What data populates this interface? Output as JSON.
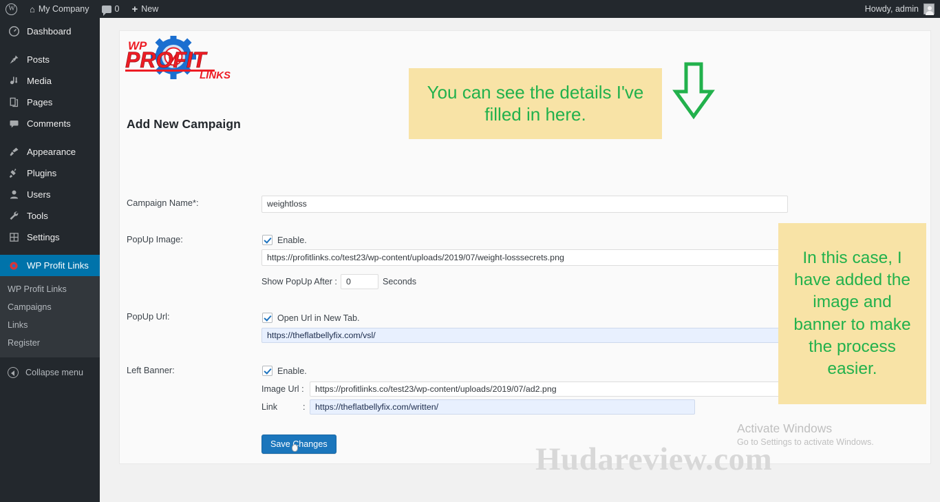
{
  "adminbar": {
    "wp_logo": "wordpress-logo-icon",
    "site_name": "My Company",
    "comments_count": "0",
    "new_label": "New",
    "howdy": "Howdy, admin"
  },
  "sidebar": {
    "items": [
      {
        "label": "Dashboard",
        "icon": "dashboard-icon",
        "glyph": "◉"
      },
      {
        "label": "Posts",
        "icon": "pin-icon",
        "glyph": "✎"
      },
      {
        "label": "Media",
        "icon": "media-icon",
        "glyph": "▣"
      },
      {
        "label": "Pages",
        "icon": "pages-icon",
        "glyph": "❐"
      },
      {
        "label": "Comments",
        "icon": "comment-icon",
        "glyph": "▬"
      },
      {
        "label": "Appearance",
        "icon": "brush-icon",
        "glyph": "✄"
      },
      {
        "label": "Plugins",
        "icon": "plug-icon",
        "glyph": "⚲"
      },
      {
        "label": "Users",
        "icon": "user-icon",
        "glyph": "☗"
      },
      {
        "label": "Tools",
        "icon": "wrench-icon",
        "glyph": "⚒"
      },
      {
        "label": "Settings",
        "icon": "settings-icon",
        "glyph": "⛭"
      }
    ],
    "active_item": {
      "label": "WP Profit Links",
      "icon": "profit-links-icon"
    },
    "submenu": [
      {
        "label": "WP Profit Links"
      },
      {
        "label": "Campaigns"
      },
      {
        "label": "Links"
      },
      {
        "label": "Register"
      }
    ],
    "collapse_label": "Collapse menu"
  },
  "logo": {
    "wp": "WP",
    "profit": "PROFIT",
    "links": "LINKS",
    "red": "#ED1C24",
    "blue": "#1B6FD0"
  },
  "main": {
    "page_title": "Add New Campaign",
    "fields": {
      "campaign_name": {
        "label": "Campaign Name*:",
        "value": "weightloss"
      },
      "popup_image": {
        "label": "PopUp Image:",
        "enable_label": "Enable.",
        "url": "https://profitlinks.co/test23/wp-content/uploads/2019/07/weight-losssecrets.png",
        "delay_label": "Show PopUp After :",
        "delay_value": "0",
        "delay_unit": "Seconds"
      },
      "popup_url": {
        "label": "PopUp Url:",
        "enable_label": "Open Url in New Tab.",
        "url": "https://theflatbellyfix.com/vsl/"
      },
      "left_banner": {
        "label": "Left Banner:",
        "enable_label": "Enable.",
        "image_url_label": "Image Url :",
        "image_url": "https://profitlinks.co/test23/wp-content/uploads/2019/07/ad2.png",
        "link_label": "Link",
        "link_colon": ":",
        "link_url": "https://theflatbellyfix.com/written/"
      }
    },
    "save_button": "Save Changes"
  },
  "annotations": {
    "note_top": "You can see the details I've filled in here.",
    "note_right": "In this case, I have added the image and banner to make the process easier.",
    "arrow": "down-arrow-icon",
    "note_bg": "#F8E3A6",
    "note_text_color": "#22B14C"
  },
  "overlays": {
    "watermark": "Hudareview.com",
    "windows_activate_title": "Activate Windows",
    "windows_activate_sub": "Go to Settings to activate Windows."
  }
}
